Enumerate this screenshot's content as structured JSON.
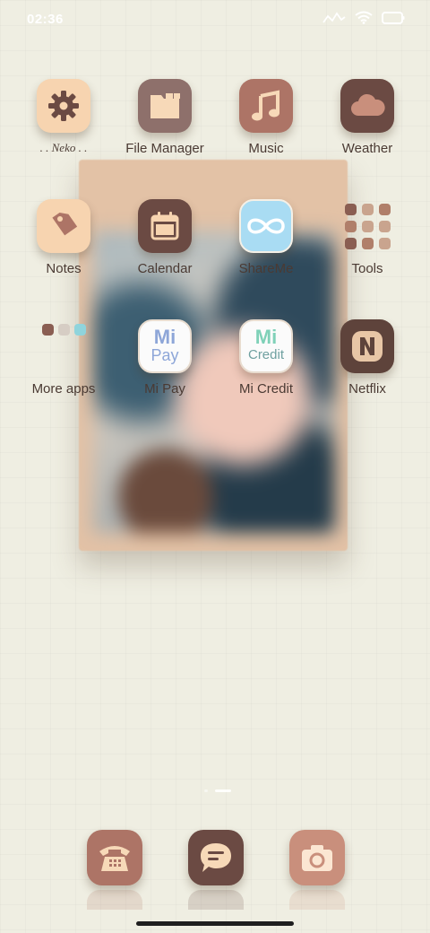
{
  "status_bar": {
    "time": "02:36",
    "icons": [
      "signal-icon",
      "wifi-icon",
      "battery-icon"
    ]
  },
  "apps": [
    {
      "label": ". . Neko . .",
      "icon": "gear-icon",
      "color": "#f7d4b0"
    },
    {
      "label": "File Manager",
      "icon": "folder-icon",
      "color": "#8e706b"
    },
    {
      "label": "Music",
      "icon": "music-note-icon",
      "color": "#ad7466"
    },
    {
      "label": "Weather",
      "icon": "cloud-icon",
      "color": "#6b4a43"
    },
    {
      "label": "Notes",
      "icon": "tag-icon",
      "color": "#f7d4b0"
    },
    {
      "label": "Calendar",
      "icon": "calendar-icon",
      "color": "#6b4a43"
    },
    {
      "label": "ShareMe",
      "icon": "infinity-icon",
      "color": "#a9dcf3"
    },
    {
      "label": "Tools",
      "icon": "folder-grid-icon",
      "color": "#c9a48e"
    },
    {
      "label": "More apps",
      "icon": "folder-grid-icon",
      "color": "#8a5e52"
    },
    {
      "label": "Mi Pay",
      "icon_text": [
        "Mi",
        "Pay"
      ],
      "color": "#8ea6d8"
    },
    {
      "label": "Mi Credit",
      "icon_text": [
        "Mi",
        "Credit"
      ],
      "color": "#6fa0a0"
    },
    {
      "label": "Netflix",
      "icon": "netflix-n-icon",
      "color": "#5e433b"
    }
  ],
  "dock": [
    {
      "name": "Phone",
      "icon": "telephone-icon",
      "color": "#ad7466"
    },
    {
      "name": "Messages",
      "icon": "chat-bubble-icon",
      "color": "#6b4a43"
    },
    {
      "name": "Camera",
      "icon": "camera-icon",
      "color": "#c98f7c"
    }
  ]
}
